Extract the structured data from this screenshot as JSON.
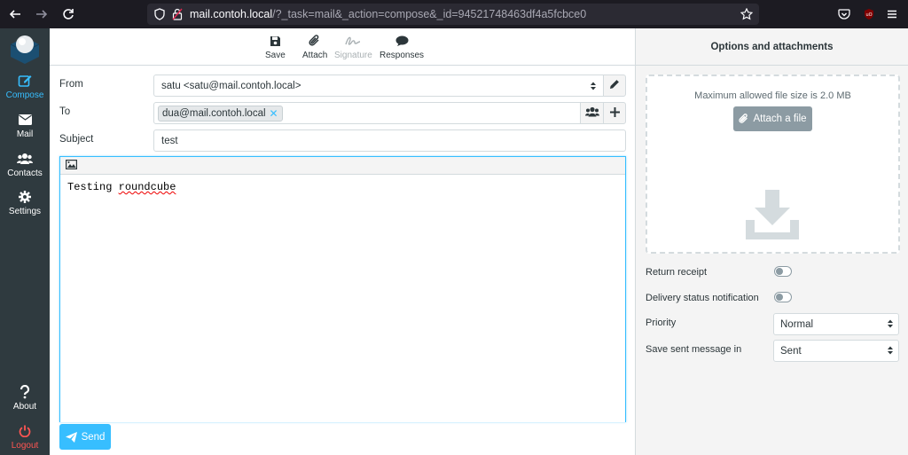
{
  "browser": {
    "url_host": "mail.contoh.local",
    "url_path": "/?_task=mail&_action=compose&_id=94521748463df4a5fcbce0"
  },
  "sidebar": {
    "items": [
      {
        "label": "Compose"
      },
      {
        "label": "Mail"
      },
      {
        "label": "Contacts"
      },
      {
        "label": "Settings"
      },
      {
        "label": "About"
      },
      {
        "label": "Logout"
      }
    ]
  },
  "toolbar": {
    "save": "Save",
    "attach": "Attach",
    "signature": "Signature",
    "responses": "Responses"
  },
  "compose": {
    "from_label": "From",
    "from_value": "satu <satu@mail.contoh.local>",
    "to_label": "To",
    "to_recipient": "dua@mail.contoh.local",
    "subject_label": "Subject",
    "subject_value": "test",
    "body_word1": "Testing",
    "body_word2": "roundcube",
    "send": "Send"
  },
  "options": {
    "title": "Options and attachments",
    "max_size": "Maximum allowed file size is 2.0 MB",
    "attach_file": "Attach a file",
    "return_receipt": "Return receipt",
    "return_receipt_on": false,
    "dsn": "Delivery status notification",
    "dsn_on": false,
    "priority_label": "Priority",
    "priority_value": "Normal",
    "save_in_label": "Save sent message in",
    "save_in_value": "Sent"
  },
  "colors": {
    "accent": "#37beff",
    "sidebar_bg": "#2f3a3f",
    "logout": "#ff5552"
  }
}
